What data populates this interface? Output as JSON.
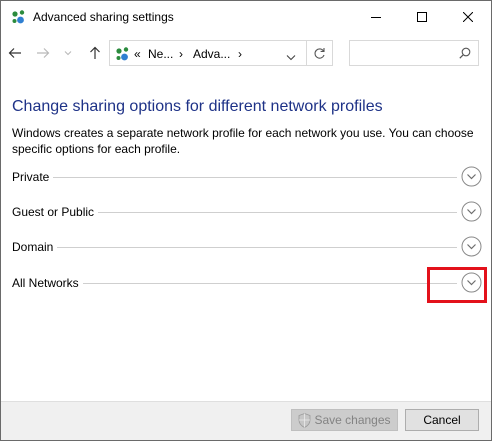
{
  "window": {
    "title": "Advanced sharing settings",
    "icon": "network-sharing-icon"
  },
  "nav": {
    "back_icon": "arrow-left-icon",
    "forward_icon": "arrow-right-icon",
    "recent_icon": "chevron-down-icon",
    "up_icon": "arrow-up-icon",
    "breadcrumb": {
      "overflow": "«",
      "items": [
        "Ne...",
        "Adva..."
      ],
      "separator": "›"
    },
    "refresh_icon": "refresh-icon",
    "search": {
      "placeholder": "",
      "value": ""
    }
  },
  "main": {
    "heading": "Change sharing options for different network profiles",
    "description": "Windows creates a separate network profile for each network you use. You can choose specific options for each profile.",
    "sections": [
      {
        "label": "Private"
      },
      {
        "label": "Guest or Public"
      },
      {
        "label": "Domain"
      },
      {
        "label": "All Networks"
      }
    ]
  },
  "footer": {
    "save_label": "Save changes",
    "cancel_label": "Cancel",
    "save_enabled": false
  },
  "colors": {
    "heading": "#1e3287",
    "highlight": "#e3111b",
    "footer_bg": "#f0f0f0"
  }
}
